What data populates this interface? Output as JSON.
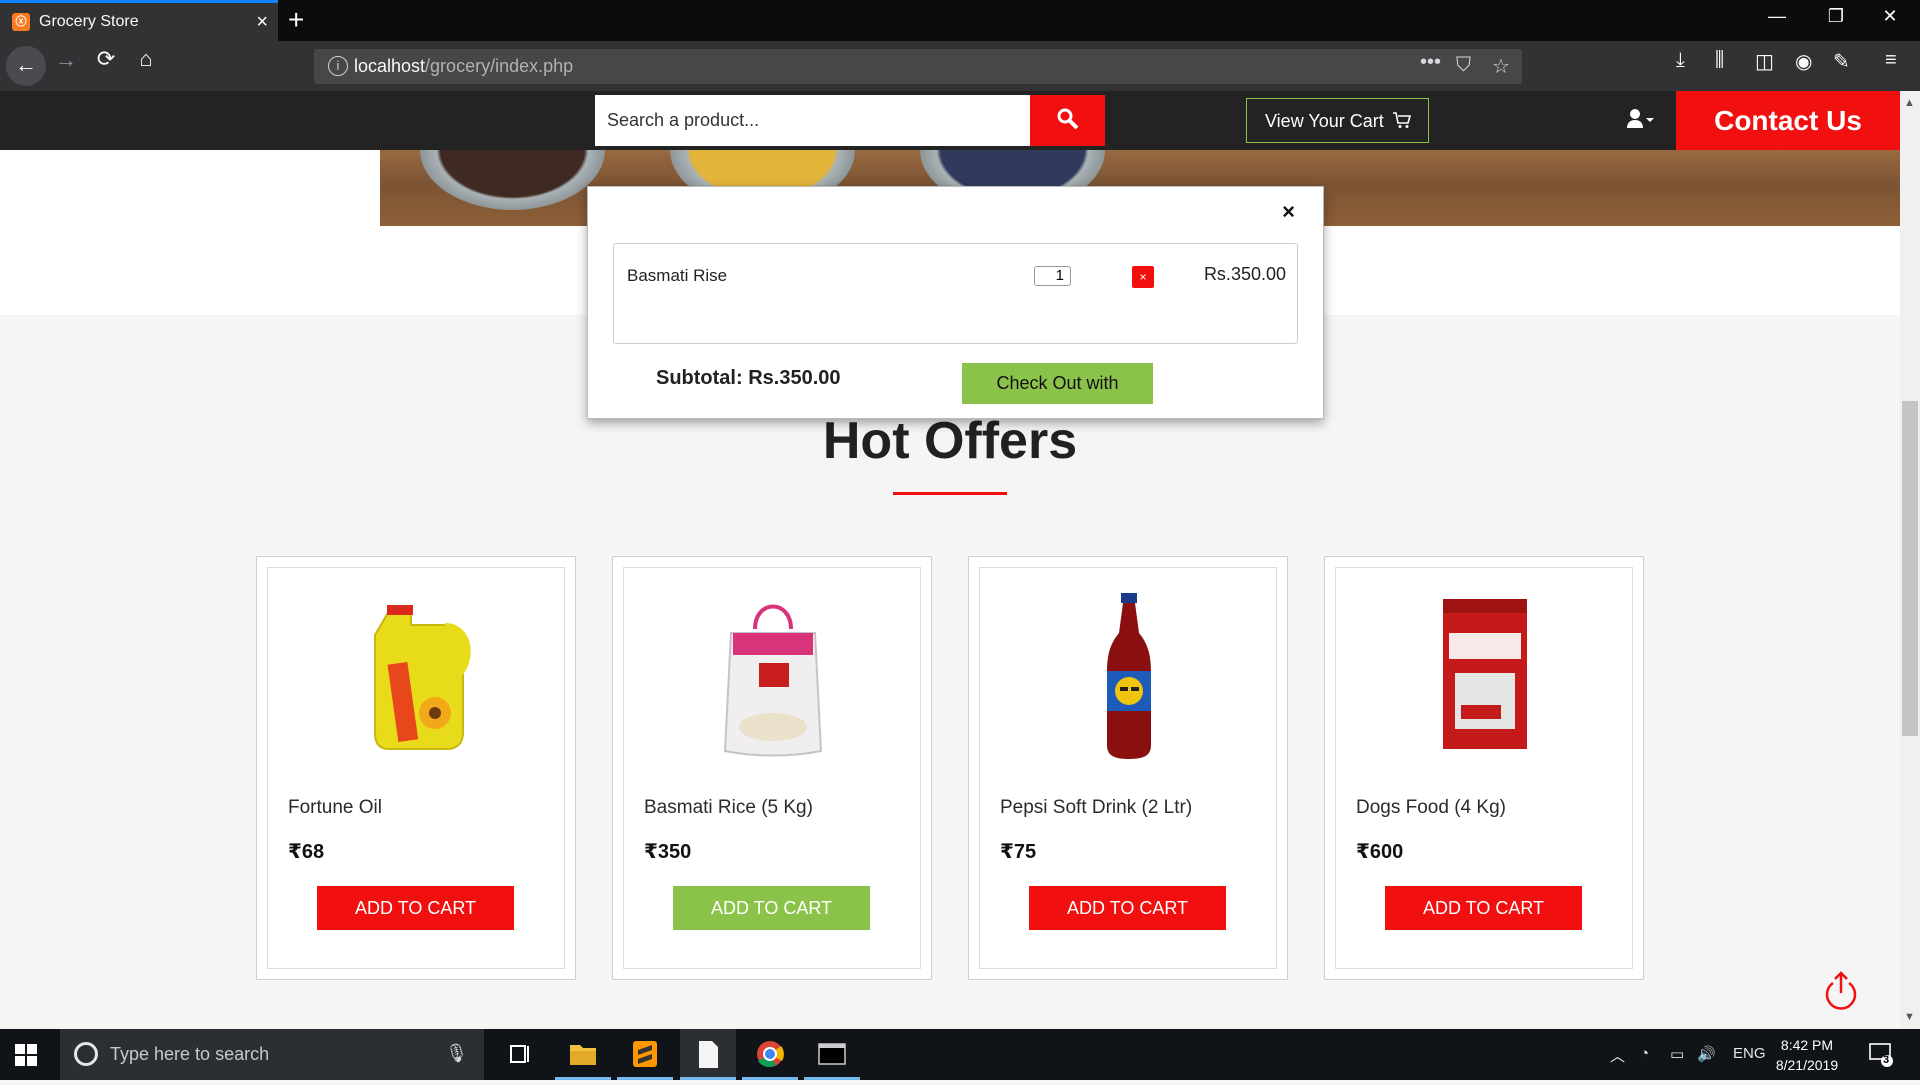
{
  "browser": {
    "tab_title": "Grocery Store",
    "tab_close": "×",
    "new_tab": "+",
    "url_host": "localhost",
    "url_path": "/grocery/index.php",
    "page_actions": "•••",
    "window_controls": [
      "—",
      "❐",
      "✕"
    ]
  },
  "header": {
    "search_placeholder": "Search a product...",
    "view_cart_label": "View Your Cart",
    "contact_label": "Contact Us"
  },
  "cart_modal": {
    "close_label": "×",
    "items": [
      {
        "name": "Basmati Rise",
        "qty": "1",
        "remove_label": "×",
        "price": "Rs.350.00"
      }
    ],
    "subtotal": "Subtotal: Rs.350.00",
    "checkout_label": "Check Out with"
  },
  "offers": {
    "title": "Hot Offers",
    "products": [
      {
        "name": "Fortune Oil",
        "price": "₹68",
        "button": "ADD TO CART",
        "button_color": "#f10f0f",
        "icon": "oil-can-icon"
      },
      {
        "name": "Basmati Rice (5 Kg)",
        "price": "₹350",
        "button": "ADD TO CART",
        "button_color": "#8bc34a",
        "icon": "rice-bag-icon"
      },
      {
        "name": "Pepsi Soft Drink (2 Ltr)",
        "price": "₹75",
        "button": "ADD TO CART",
        "button_color": "#f10f0f",
        "icon": "soda-bottle-icon"
      },
      {
        "name": "Dogs Food (4 Kg)",
        "price": "₹600",
        "button": "ADD TO CART",
        "button_color": "#f10f0f",
        "icon": "dog-food-bag-icon"
      }
    ]
  },
  "taskbar": {
    "search_text": "Type here to search",
    "language": "ENG",
    "time": "8:42 PM",
    "date": "8/21/2019",
    "notification_count": "3"
  },
  "colors": {
    "accent_red": "#f10f0f",
    "accent_green": "#8bc34a",
    "header_dark": "#232323"
  }
}
